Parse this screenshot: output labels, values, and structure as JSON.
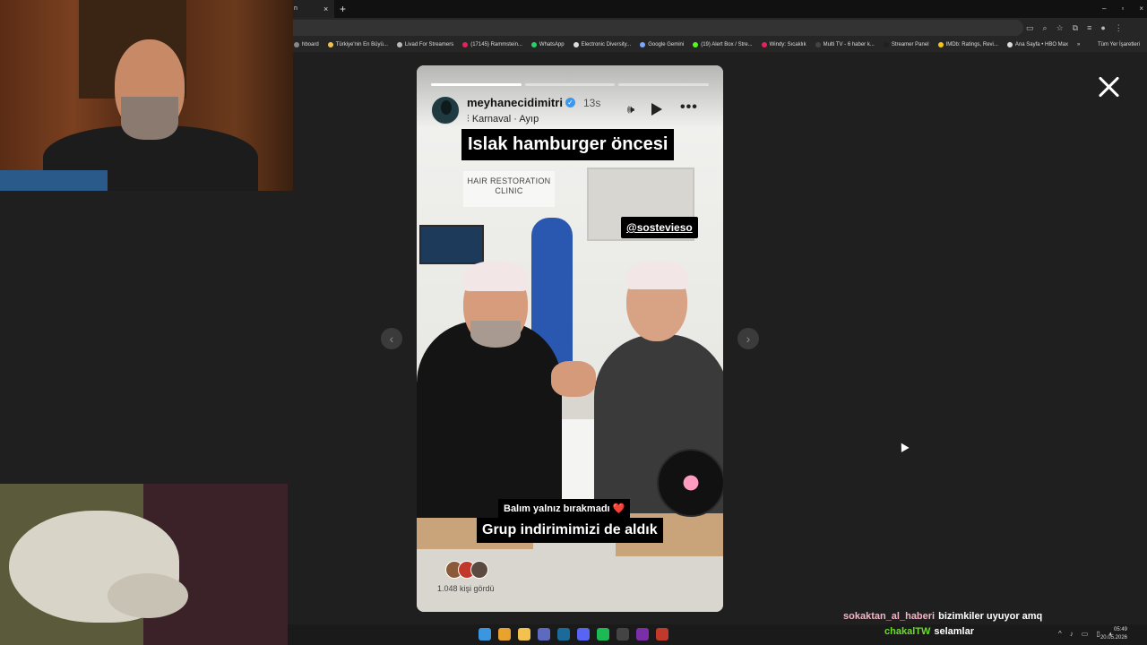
{
  "browser": {
    "tab_title": "n",
    "tab_close": "×",
    "new_tab": "+",
    "window_controls": [
      "–",
      "▫",
      "×"
    ],
    "bookmarks": [
      {
        "label": "hboard",
        "color": "#888888"
      },
      {
        "label": "Türkiye'nin En Büyü...",
        "color": "#f2c14e"
      },
      {
        "label": "Livad For Streamers",
        "color": "#bbbbbb"
      },
      {
        "label": "(17145) Rammstein...",
        "color": "#e0245e"
      },
      {
        "label": "WhatsApp",
        "color": "#25d366"
      },
      {
        "label": "Electronic Diversity...",
        "color": "#dddddd"
      },
      {
        "label": "Google Gemini",
        "color": "#7aa7ff"
      },
      {
        "label": "(19) Alert Box / Stre...",
        "color": "#53fc18"
      },
      {
        "label": "Windy: Sıcaklık",
        "color": "#e0245e"
      },
      {
        "label": "Multi TV - 6 haber k...",
        "color": "#444444"
      },
      {
        "label": "Streamer Panel",
        "color": "#1f1f1f"
      },
      {
        "label": "IMDb: Ratings, Revi...",
        "color": "#f5c518"
      },
      {
        "label": "Ana Sayfa • HBO Max",
        "color": "#dddddd"
      }
    ],
    "bookmarks_more": "»",
    "bookmarks_all": "Tüm Yer İşaretleri"
  },
  "story": {
    "username": "meyhanecidimitri",
    "verified_glyph": "✓",
    "time_ago": "13s",
    "music": "Karnaval · Ayıp",
    "progress_done": 1,
    "progress_total": 3,
    "title_caption": "Islak hamburger öncesi",
    "mention": "@sostevieso",
    "sign_text": "HAIR RESTORATION CLINIC",
    "caption_line1": "Balım yalnız bırakmadı ❤️",
    "caption_line2": "Grup indirimimizi de aldık",
    "seen_by": "1.048 kişi gördü",
    "mute_glyph": "🕪",
    "more_glyph": "•••",
    "prev_glyph": "‹",
    "next_glyph": "›"
  },
  "chat": [
    {
      "user": "sokaktan_al_haberi",
      "message": "bizimkiler uyuyor amq"
    },
    {
      "user": "chakalTW",
      "message": "selamlar"
    }
  ],
  "taskbar": {
    "clock_time": "05:49",
    "clock_date": "20.05.2026",
    "apps": [
      {
        "name": "windows-start",
        "color": "#3a96dd"
      },
      {
        "name": "chrome",
        "color": "#e8a32e"
      },
      {
        "name": "file-explorer",
        "color": "#f2c14e"
      },
      {
        "name": "obs",
        "color": "#5c6bc0"
      },
      {
        "name": "steam",
        "color": "#1b6b9a"
      },
      {
        "name": "discord",
        "color": "#5865f2"
      },
      {
        "name": "spotify",
        "color": "#1db954"
      },
      {
        "name": "epic",
        "color": "#444444"
      },
      {
        "name": "next",
        "color": "#7a2ea8"
      },
      {
        "name": "app-red",
        "color": "#c0392b"
      }
    ]
  },
  "colors": {
    "page_bg": "#1f1f1f",
    "chat_user1": "#f3b5c4",
    "chat_user2": "#6bdc2e"
  }
}
